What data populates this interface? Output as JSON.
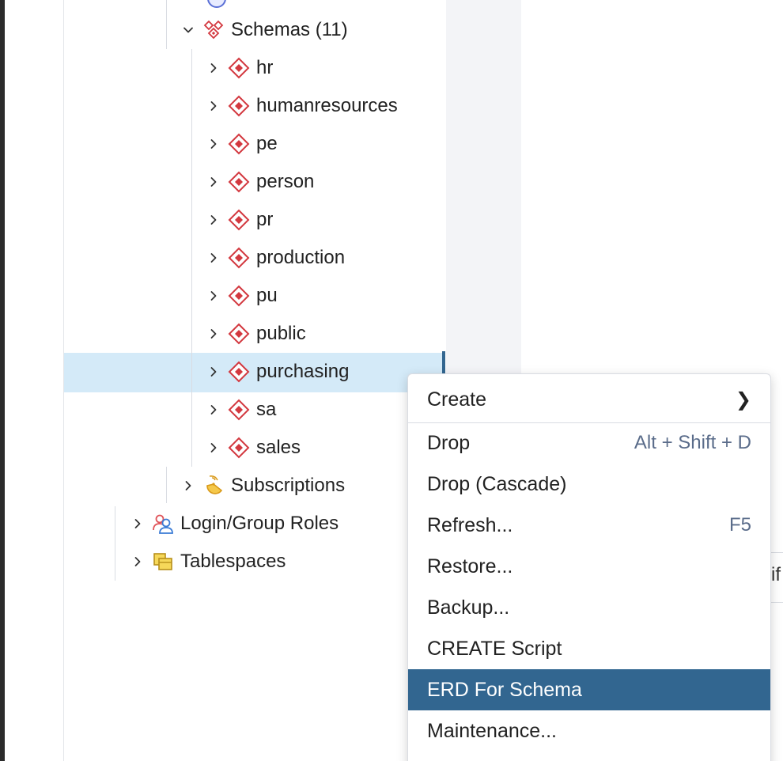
{
  "colors": {
    "selected_row_bg": "#d4eaf8",
    "menu_highlight_bg": "#326690",
    "schema_icon": "#d3383f",
    "shortcut_text": "#5a6c8a"
  },
  "tree": {
    "schemas_label": "Schemas (11)",
    "schemas_icon": "schemas-icon",
    "schema_items": [
      {
        "label": "hr",
        "icon": "schema-icon"
      },
      {
        "label": "humanresources",
        "icon": "schema-icon"
      },
      {
        "label": "pe",
        "icon": "schema-icon"
      },
      {
        "label": "person",
        "icon": "schema-icon"
      },
      {
        "label": "pr",
        "icon": "schema-icon"
      },
      {
        "label": "production",
        "icon": "schema-icon"
      },
      {
        "label": "pu",
        "icon": "schema-icon"
      },
      {
        "label": "public",
        "icon": "schema-icon"
      },
      {
        "label": "purchasing",
        "icon": "schema-icon",
        "selected": true
      },
      {
        "label": "sa",
        "icon": "schema-icon"
      },
      {
        "label": "sales",
        "icon": "schema-icon"
      }
    ],
    "subscriptions_label": "Subscriptions",
    "login_roles_label": "Login/Group Roles",
    "tablespaces_label": "Tablespaces"
  },
  "context_menu": {
    "items": [
      {
        "label": "Create",
        "submenu_glyph": "❯"
      },
      {
        "label": "Drop",
        "shortcut": "Alt + Shift + D"
      },
      {
        "label": "Drop (Cascade)"
      },
      {
        "label": "Refresh...",
        "shortcut": "F5"
      },
      {
        "label": "Restore..."
      },
      {
        "label": "Backup..."
      },
      {
        "label": "CREATE Script"
      },
      {
        "label": "ERD For Schema",
        "highlighted": true
      },
      {
        "label": "Maintenance..."
      }
    ]
  },
  "right_panel": {
    "cut_text": "if"
  }
}
